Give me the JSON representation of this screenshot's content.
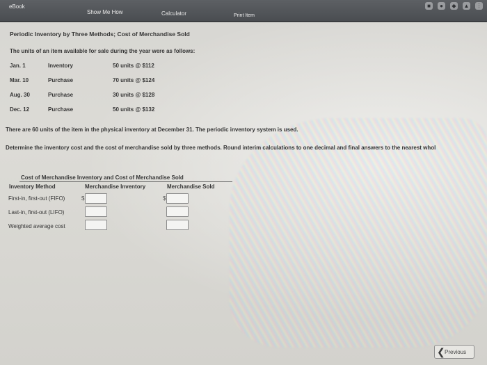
{
  "tabs": {
    "ebook": "eBook",
    "show_me_how": "Show Me How",
    "calculator": "Calculator",
    "print_item": "Print Item"
  },
  "problem": {
    "title": "Periodic Inventory by Three Methods; Cost of Merchandise Sold",
    "intro": "The units of an item available for sale during the year were as follows:",
    "rows": [
      {
        "date": "Jan. 1",
        "type": "Inventory",
        "units": "50 units @ $112"
      },
      {
        "date": "Mar. 10",
        "type": "Purchase",
        "units": "70 units @ $124"
      },
      {
        "date": "Aug. 30",
        "type": "Purchase",
        "units": "30 units @ $128"
      },
      {
        "date": "Dec. 12",
        "type": "Purchase",
        "units": "50 units @ $132"
      }
    ],
    "physical_note": "There are 60 units of the item in the physical inventory at December 31. The periodic inventory system is used.",
    "instructions": "Determine the inventory cost and the cost of merchandise sold by three methods. Round interim calculations to one decimal and final answers to the nearest whol"
  },
  "table": {
    "heading": "Cost of Merchandise Inventory and Cost of Merchandise Sold",
    "col_method": "Inventory Method",
    "col_inventory": "Merchandise Inventory",
    "col_sold": "Merchandise Sold",
    "currency": "$",
    "methods": [
      {
        "label": "First-in, first-out (FIFO)",
        "inventory": "",
        "sold": ""
      },
      {
        "label": "Last-in, first-out (LIFO)",
        "inventory": "",
        "sold": ""
      },
      {
        "label": "Weighted average cost",
        "inventory": "",
        "sold": ""
      }
    ]
  },
  "footer": {
    "previous": "Previous"
  }
}
